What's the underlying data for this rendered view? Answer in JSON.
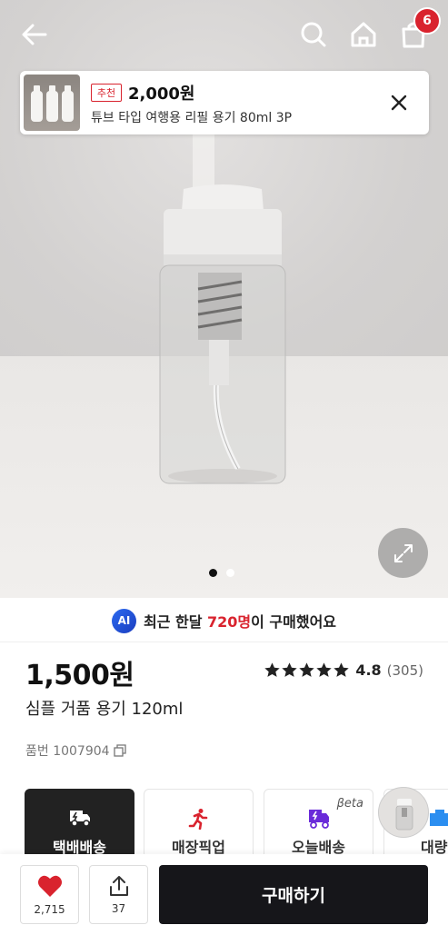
{
  "topbar": {
    "back_icon": "back-arrow-icon",
    "search_icon": "search-icon",
    "home_icon": "home-icon",
    "cart_icon": "shopping-bag-icon",
    "cart_count": "6"
  },
  "recommend": {
    "tag": "추천",
    "price": "2,000원",
    "name": "튜브 타입 여행용 리필 용기 80ml 3P"
  },
  "gallery": {
    "expand_icon": "expand-icon",
    "page_count": 2,
    "current_page": 1
  },
  "ai_banner": {
    "badge": "AI",
    "prefix": "최근 한달 ",
    "highlight": "720명",
    "suffix": "이 구매했어요"
  },
  "product": {
    "price": "1,500원",
    "name": "심플 거품 용기 120ml",
    "rating_stars": 5,
    "rating_score": "4.8",
    "rating_count": "(305)",
    "item_number": "품번 1007904"
  },
  "delivery_options": [
    {
      "label": "택배배송",
      "icon": "delivery-truck-icon",
      "active": true
    },
    {
      "label": "매장픽업",
      "icon": "running-person-icon",
      "active": false
    },
    {
      "label": "오늘배송",
      "icon": "today-delivery-icon",
      "active": false,
      "badge": "βeta"
    },
    {
      "label": "대량주",
      "icon": "bulk-order-icon",
      "active": false
    }
  ],
  "bottombar": {
    "like_count": "2,715",
    "share_count": "37",
    "buy_label": "구매하기"
  },
  "colors": {
    "accent_red": "#d9232e",
    "dark": "#16161a",
    "ai_blue": "#2b6af0"
  }
}
